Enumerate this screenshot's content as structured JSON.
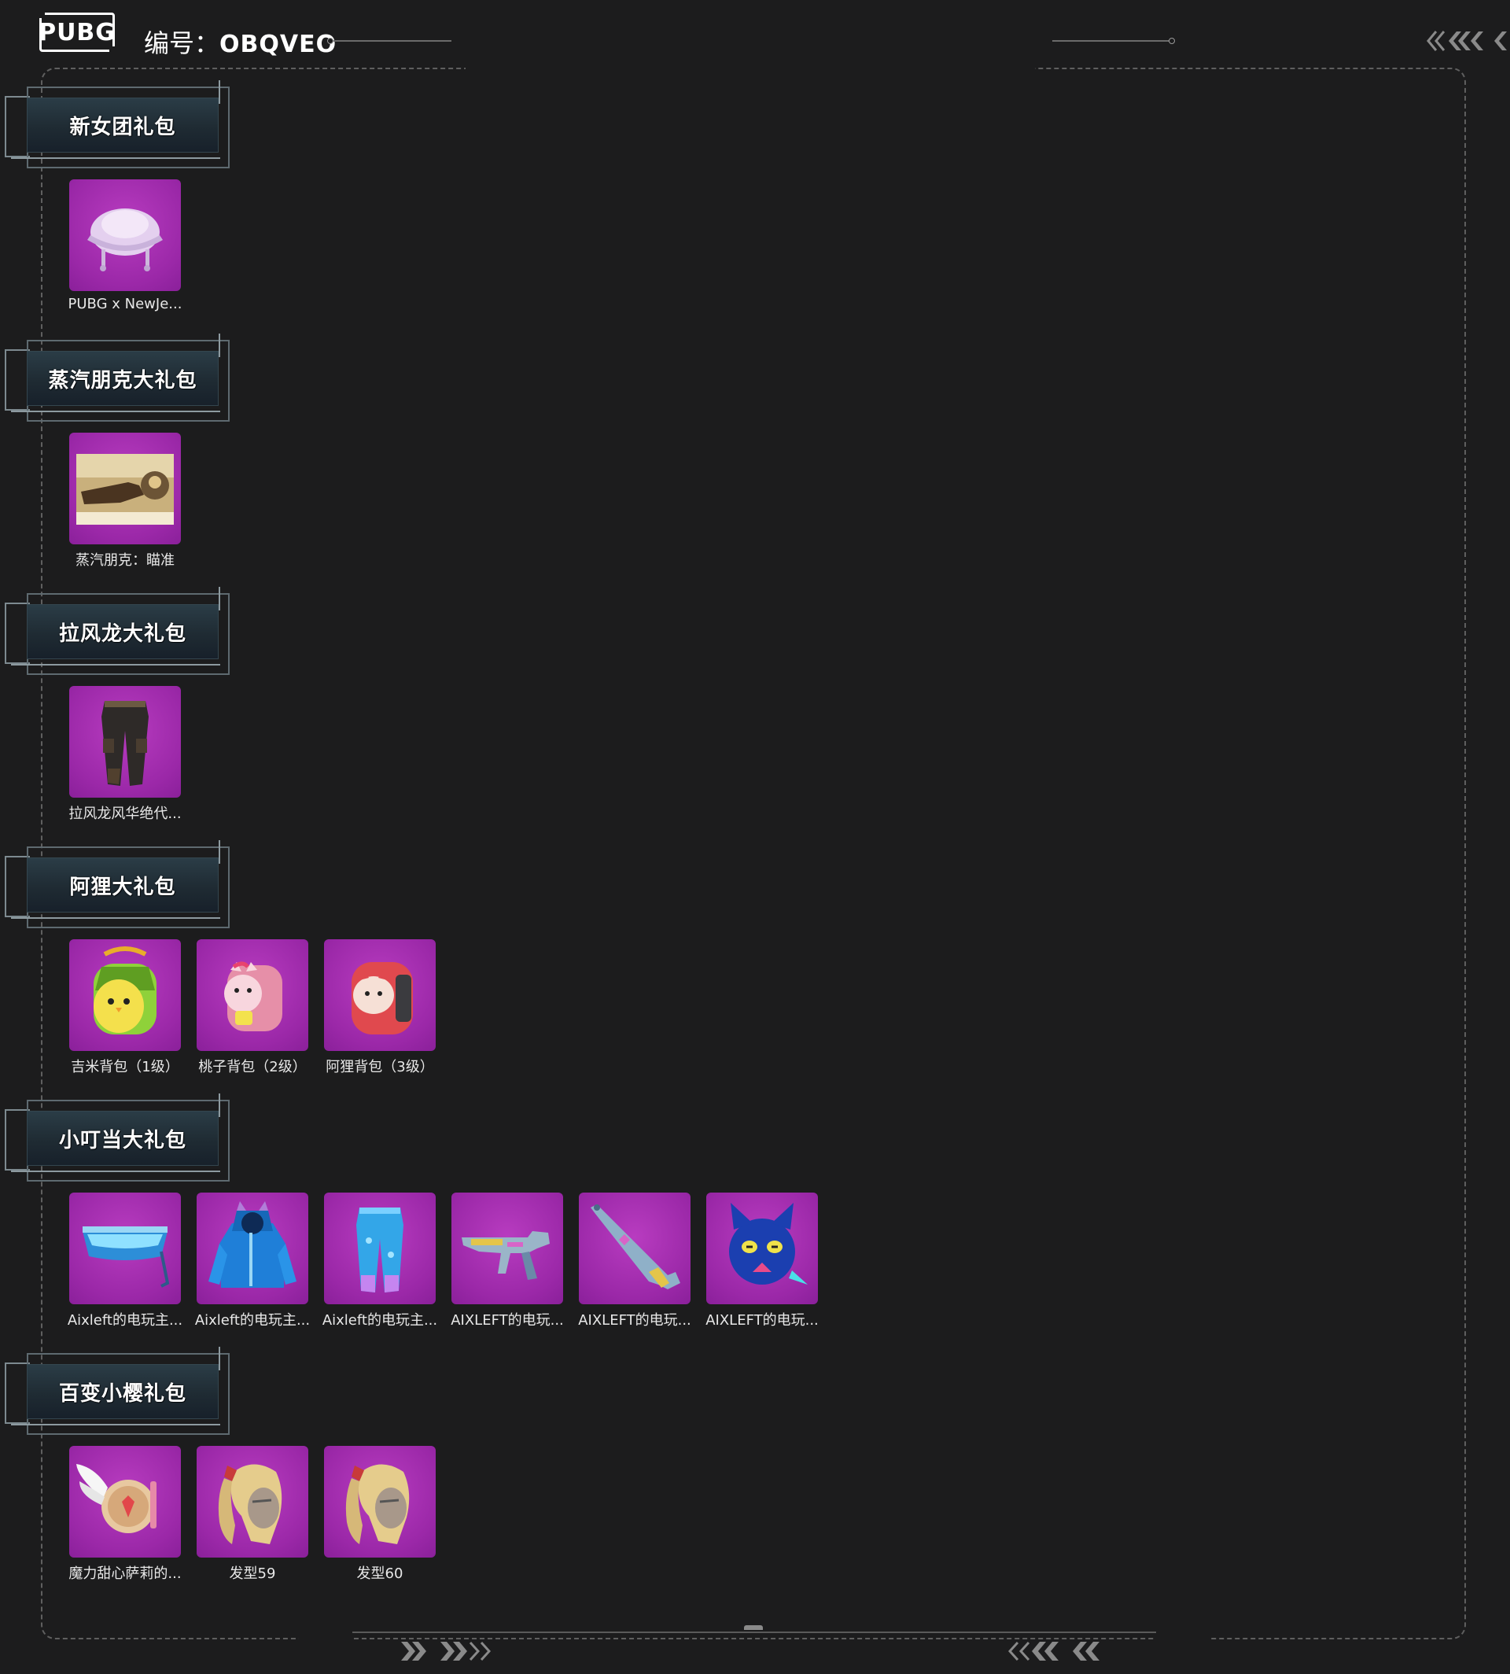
{
  "header": {
    "logo_text": "PUBG",
    "id_prefix": "编号：",
    "id_code": "OBQVEO"
  },
  "sections": [
    {
      "title": "新女团礼包",
      "items": [
        {
          "label": "PUBG x NewJe...",
          "icon": "helmet-icon"
        }
      ]
    },
    {
      "title": "蒸汽朋克大礼包",
      "items": [
        {
          "label": "蒸汽朋克：瞄准",
          "icon": "steampunk-scene-icon"
        }
      ]
    },
    {
      "title": "拉风龙大礼包",
      "items": [
        {
          "label": "拉风龙风华绝代...",
          "icon": "pants-icon"
        }
      ]
    },
    {
      "title": "阿狸大礼包",
      "items": [
        {
          "label": "吉米背包（1级）",
          "icon": "green-backpack-icon"
        },
        {
          "label": "桃子背包（2级）",
          "icon": "pink-backpack-icon"
        },
        {
          "label": "阿狸背包（3级）",
          "icon": "red-backpack-icon"
        }
      ]
    },
    {
      "title": "小叮当大礼包",
      "items": [
        {
          "label": "Aixleft的电玩主...",
          "icon": "visor-glasses-icon"
        },
        {
          "label": "Aixleft的电玩主...",
          "icon": "hoodie-icon"
        },
        {
          "label": "Aixleft的电玩主...",
          "icon": "blue-pants-icon"
        },
        {
          "label": "AIXLEFT的电玩...",
          "icon": "smg-icon"
        },
        {
          "label": "AIXLEFT的电玩...",
          "icon": "sniper-rifle-icon"
        },
        {
          "label": "AIXLEFT的电玩...",
          "icon": "cat-helmet-icon"
        }
      ]
    },
    {
      "title": "百变小樱礼包",
      "items": [
        {
          "label": "魔力甜心萨莉的...",
          "icon": "winged-backpack-icon"
        },
        {
          "label": "发型59",
          "icon": "hairstyle-icon"
        },
        {
          "label": "发型60",
          "icon": "hairstyle-icon"
        }
      ]
    }
  ],
  "colors": {
    "background": "#1c1c1d",
    "item_bg": "#9b28a8",
    "frame": "#5f5f5f"
  }
}
